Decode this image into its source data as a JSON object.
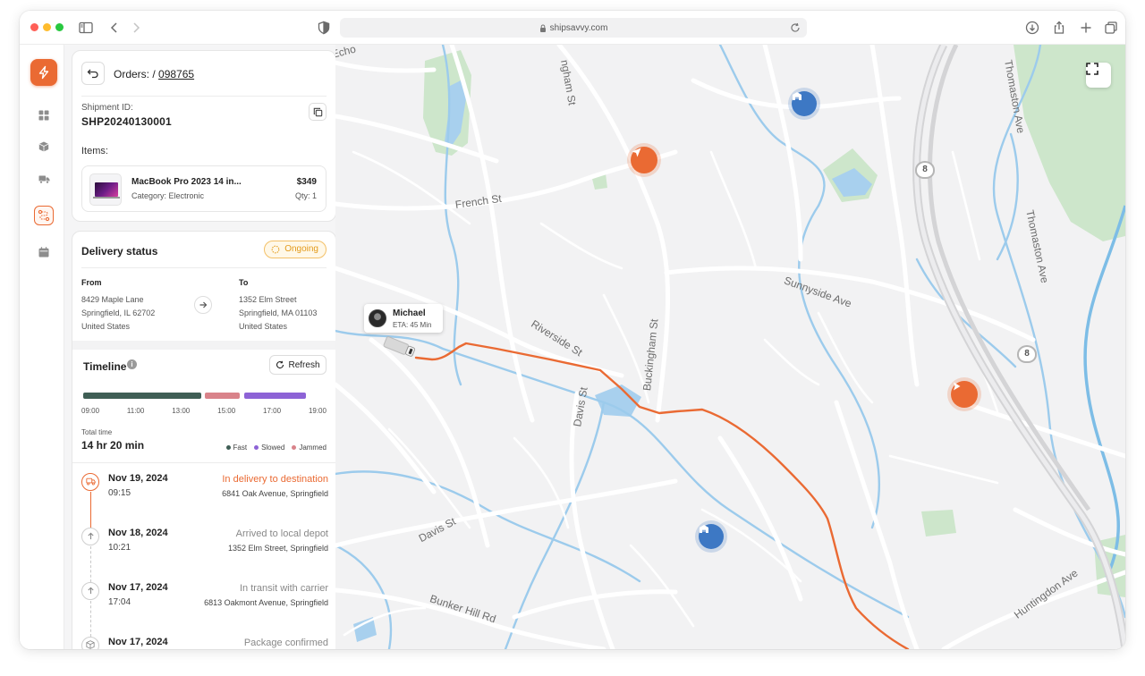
{
  "browser": {
    "url": "shipsavvy.com"
  },
  "colors": {
    "accent": "#ea6a33",
    "ongoing": "#e39a1a",
    "fast": "#3f5e55",
    "slowed": "#8d63d6",
    "jammed": "#d9838a",
    "route": "#ea6a33",
    "depot": "#3d78c4"
  },
  "rail": {
    "items": [
      {
        "name": "dashboard-icon"
      },
      {
        "name": "box-icon"
      },
      {
        "name": "truck-icon"
      },
      {
        "name": "route-icon",
        "active": true
      },
      {
        "name": "calendar-icon"
      }
    ]
  },
  "order": {
    "breadcrumb_prefix": "Orders: /",
    "breadcrumb_id": "098765",
    "shipment_label": "Shipment ID:",
    "shipment_id": "SHP20240130001",
    "items_label": "Items:",
    "item": {
      "name": "MacBook Pro 2023 14 in...",
      "category": "Category: Electronic",
      "price": "$349",
      "qty": "Qty: 1"
    }
  },
  "delivery": {
    "title": "Delivery status",
    "status": "Ongoing",
    "from_label": "From",
    "from_line1": "8429 Maple Lane",
    "from_line2": "Springfield, IL 62702",
    "from_line3": "United States",
    "to_label": "To",
    "to_line1": "1352 Elm Street",
    "to_line2": "Springfield, MA 01103",
    "to_line3": "United States"
  },
  "timeline": {
    "title": "Timeline",
    "refresh_label": "Refresh",
    "hours": [
      "09:00",
      "11:00",
      "13:00",
      "15:00",
      "17:00",
      "19:00"
    ],
    "segments": [
      {
        "type": "fast",
        "start": 0,
        "end": 0.485
      },
      {
        "type": "jammed",
        "start": 0.5,
        "end": 0.645
      },
      {
        "type": "slowed",
        "start": 0.66,
        "end": 0.915
      }
    ],
    "total_label": "Total time",
    "total_value": "14 hr 20 min",
    "legend": {
      "fast": "Fast",
      "slowed": "Slowed",
      "jammed": "Jammed"
    },
    "entries": [
      {
        "date": "Nov 19, 2024",
        "time": "09:15",
        "status": "In delivery to destination",
        "address": "6841 Oak Avenue, Springfield",
        "icon": "truck-icon",
        "active": true
      },
      {
        "date": "Nov 18, 2024",
        "time": "10:21",
        "status": "Arrived to local depot",
        "address": "1352 Elm Street, Springfield",
        "icon": "arrow-up-icon",
        "active": false
      },
      {
        "date": "Nov 17, 2024",
        "time": "17:04",
        "status": "In transit with carrier",
        "address": "6813 Oakmont Avenue, Springfield",
        "icon": "arrow-up-icon",
        "active": false
      },
      {
        "date": "Nov 17, 2024",
        "time": "",
        "status": "Package confirmed",
        "address": "",
        "icon": "package-icon",
        "active": false
      }
    ]
  },
  "map": {
    "streets": {
      "french": "French St",
      "riverside": "Riverside St",
      "buckingham": "Buckingham St",
      "buckingham_top": "ngham St",
      "davis_st": "Davis St",
      "davis_lower": "Davis St",
      "sunnyside": "Sunnyside Ave",
      "thomaston_top": "Thomaston Ave",
      "thomaston": "Thomaston Ave",
      "bunker": "Bunker Hill Rd",
      "huntingdon": "Huntingdon Ave",
      "echo": "Echo"
    },
    "route_shields": [
      "8",
      "8"
    ],
    "driver": {
      "name": "Michael",
      "eta": "ETA: 45 Min"
    }
  }
}
